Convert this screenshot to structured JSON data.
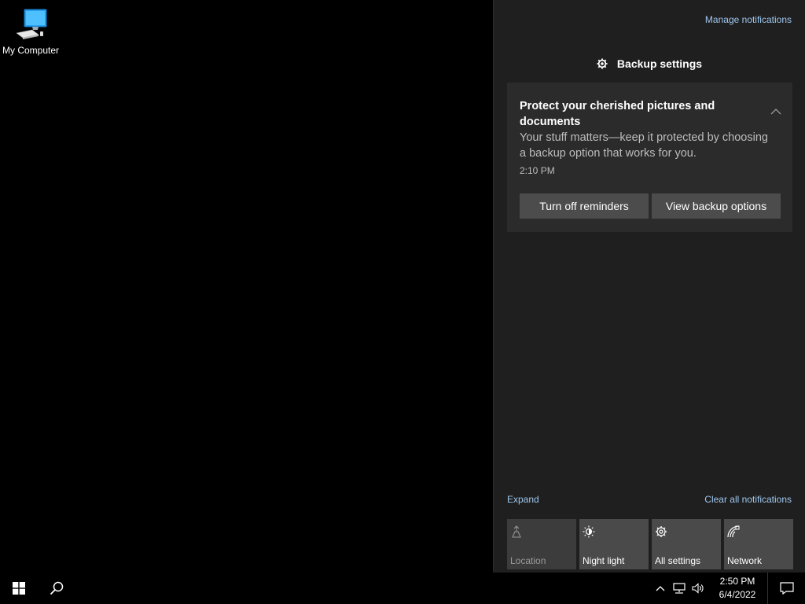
{
  "desktop": {
    "icons": [
      {
        "label": "My Computer",
        "icon": "computer-icon"
      }
    ]
  },
  "action_center": {
    "manage_link": "Manage notifications",
    "group_header": {
      "label": "Backup settings",
      "icon": "gear-icon"
    },
    "toast": {
      "title": "Protect your cherished pictures and documents",
      "body": "Your stuff matters—keep it protected by choosing a backup option that works for you.",
      "time": "2:10 PM",
      "buttons": {
        "turn_off": "Turn off reminders",
        "view_options": "View backup options"
      },
      "collapse_icon": "chevron-up-icon"
    },
    "expand_link": "Expand",
    "clear_link": "Clear all notifications",
    "quick_actions": [
      {
        "label": "Location",
        "icon": "location-icon",
        "enabled": false
      },
      {
        "label": "Night light",
        "icon": "night-light-icon",
        "enabled": true
      },
      {
        "label": "All settings",
        "icon": "settings-icon",
        "enabled": true
      },
      {
        "label": "Network",
        "icon": "network-icon",
        "enabled": true
      }
    ]
  },
  "taskbar": {
    "start_icon": "windows-logo-icon",
    "search_icon": "search-icon",
    "tray": {
      "icons": [
        "chevron-up-icon",
        "network-icon",
        "volume-icon"
      ],
      "time": "2:50 PM",
      "date": "6/4/2022"
    },
    "notification_icon": "action-center-icon"
  },
  "colors": {
    "panel_bg": "#1f1f1f",
    "toast_bg": "#2b2b2b",
    "button_bg": "#4c4c4c",
    "link": "#9ec7ee",
    "tile_bg": "#4a4a4a"
  }
}
